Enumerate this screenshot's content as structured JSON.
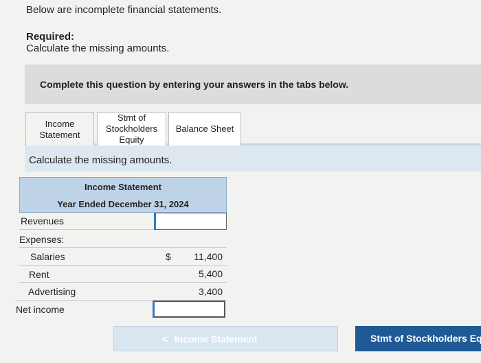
{
  "question": {
    "intro": "Below are incomplete financial statements.",
    "required_heading": "Required:",
    "required_text": "Calculate the missing amounts."
  },
  "banner": {
    "text": "Complete this question by entering your answers in the tabs below."
  },
  "tabs": [
    {
      "label": "Income\nStatement",
      "active": true
    },
    {
      "label": "Stmt of\nStockholders\nEquity",
      "active": false
    },
    {
      "label": "Balance Sheet",
      "active": false
    }
  ],
  "instruction": "Calculate the missing amounts.",
  "statement": {
    "title": "Income Statement",
    "period": "Year Ended December 31, 2024",
    "rows": [
      {
        "label": "Revenues",
        "value": ""
      },
      {
        "label": "Expenses:",
        "value": ""
      },
      {
        "label": "Salaries",
        "currency": "$",
        "value": "11,400"
      },
      {
        "label": "Rent",
        "value": "5,400"
      },
      {
        "label": "Advertising",
        "value": "3,400"
      },
      {
        "label": "Net income",
        "value": ""
      }
    ]
  },
  "nav": {
    "prev_chevron": "<",
    "prev_label": "Income Statement",
    "next_label": "Stmt of Stockholders Equity"
  },
  "colors": {
    "accent": "#1f5a96",
    "header_fill": "#bfd3e8",
    "input_border": "#2e7bc4"
  }
}
